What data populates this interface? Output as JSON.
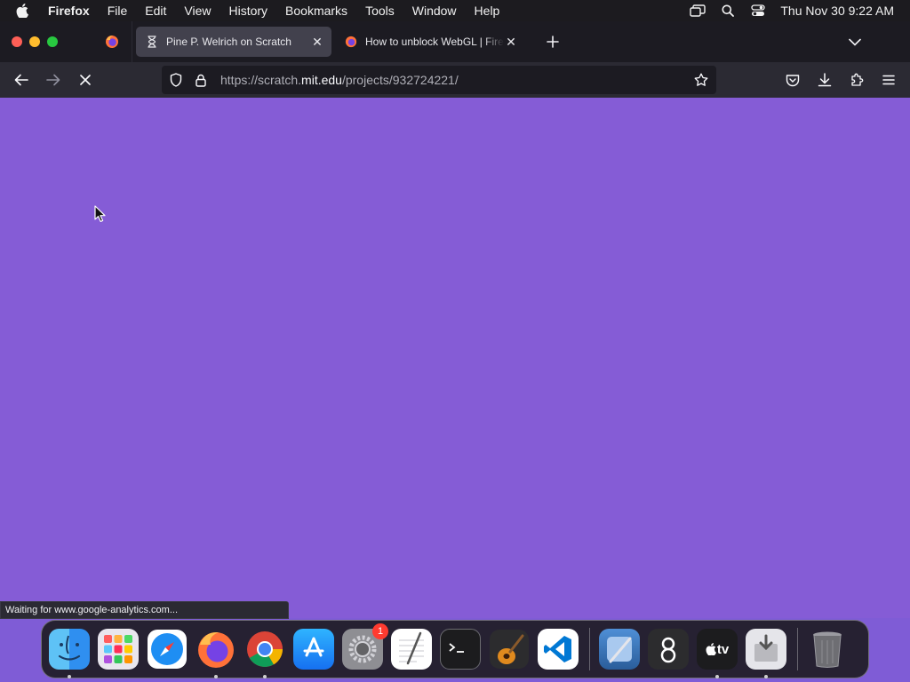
{
  "menubar": {
    "app_name": "Firefox",
    "items": [
      "File",
      "Edit",
      "View",
      "History",
      "Bookmarks",
      "Tools",
      "Window",
      "Help"
    ],
    "clock": "Thu Nov 30  9:22 AM"
  },
  "tabs": [
    {
      "title": "Pine P. Welrich on Scratch",
      "active": true
    },
    {
      "title": "How to unblock WebGL | Firefox",
      "active": false
    }
  ],
  "urlbar": {
    "prefix": "https://scratch.",
    "domain": "mit.edu",
    "path": "/projects/932724221/"
  },
  "status": "Waiting for www.google-analytics.com...",
  "dock": {
    "apps": [
      "Finder",
      "Launchpad",
      "Safari",
      "Firefox",
      "Chrome",
      "App Store",
      "System Settings",
      "TextEdit",
      "Terminal",
      "GarageBand",
      "Visual Studio Code",
      "Xcode",
      "Perplexity",
      "Apple TV",
      "Installer",
      "Trash"
    ],
    "settings_badge": "1",
    "tv_label": "tv"
  },
  "colors": {
    "page_bg": "#855cd6",
    "toolbar": "#2b2a33",
    "tabstrip": "#1c1b22"
  }
}
